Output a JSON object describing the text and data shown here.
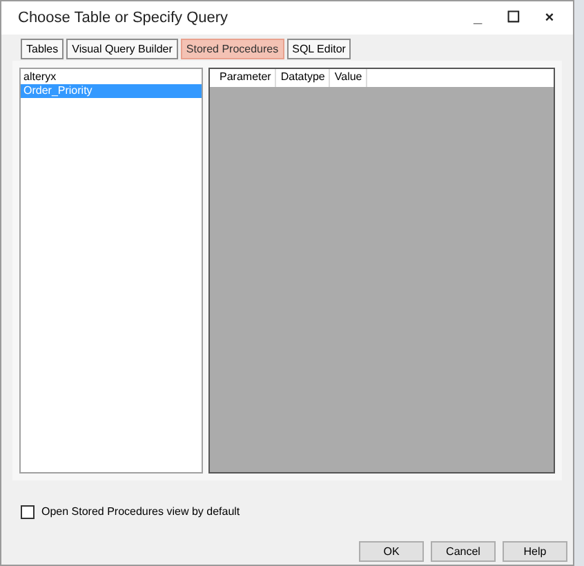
{
  "window": {
    "title": "Choose Table or Specify Query",
    "controls": [
      "_",
      "☐",
      "×"
    ]
  },
  "tabs": [
    {
      "label": "Tables",
      "selected": false
    },
    {
      "label": "Visual Query Builder",
      "selected": false
    },
    {
      "label": "Stored Procedures",
      "selected": true
    },
    {
      "label": "SQL Editor",
      "selected": false
    }
  ],
  "procedures": [
    {
      "label": "alteryx",
      "selected": false
    },
    {
      "label": "Order_Priority",
      "selected": true
    }
  ],
  "parameters": {
    "columns": [
      "Parameter",
      "Datatype",
      "Value"
    ]
  },
  "default_option": {
    "label": "Open Stored Procedures view by default",
    "checked": false
  },
  "buttons": [
    "OK",
    "Cancel",
    "Help"
  ]
}
